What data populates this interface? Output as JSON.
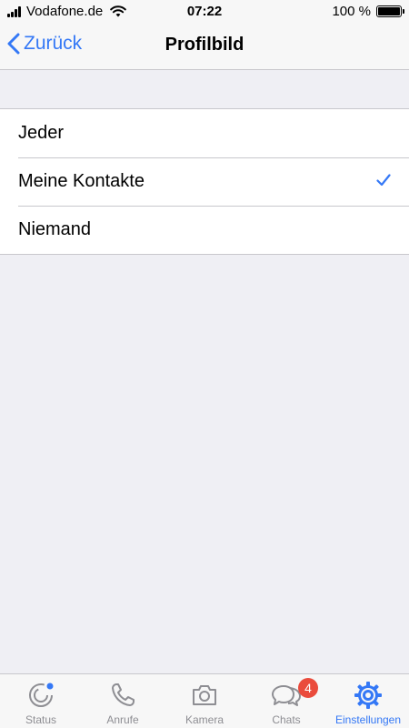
{
  "status_bar": {
    "carrier": "Vodafone.de",
    "time": "07:22",
    "battery": "100 %"
  },
  "nav": {
    "back_label": "Zurück",
    "title": "Profilbild"
  },
  "options": [
    {
      "label": "Jeder",
      "selected": false
    },
    {
      "label": "Meine Kontakte",
      "selected": true
    },
    {
      "label": "Niemand",
      "selected": false
    }
  ],
  "tabs": [
    {
      "label": "Status",
      "icon": "status-icon"
    },
    {
      "label": "Anrufe",
      "icon": "phone-icon"
    },
    {
      "label": "Kamera",
      "icon": "camera-icon"
    },
    {
      "label": "Chats",
      "icon": "chat-bubbles-icon",
      "badge": "4"
    },
    {
      "label": "Einstellungen",
      "icon": "gear-icon",
      "active": true
    }
  ],
  "colors": {
    "accent": "#3478f6",
    "badge": "#ea4b3c",
    "inactive": "#8e8e93",
    "background": "#efeff4"
  }
}
